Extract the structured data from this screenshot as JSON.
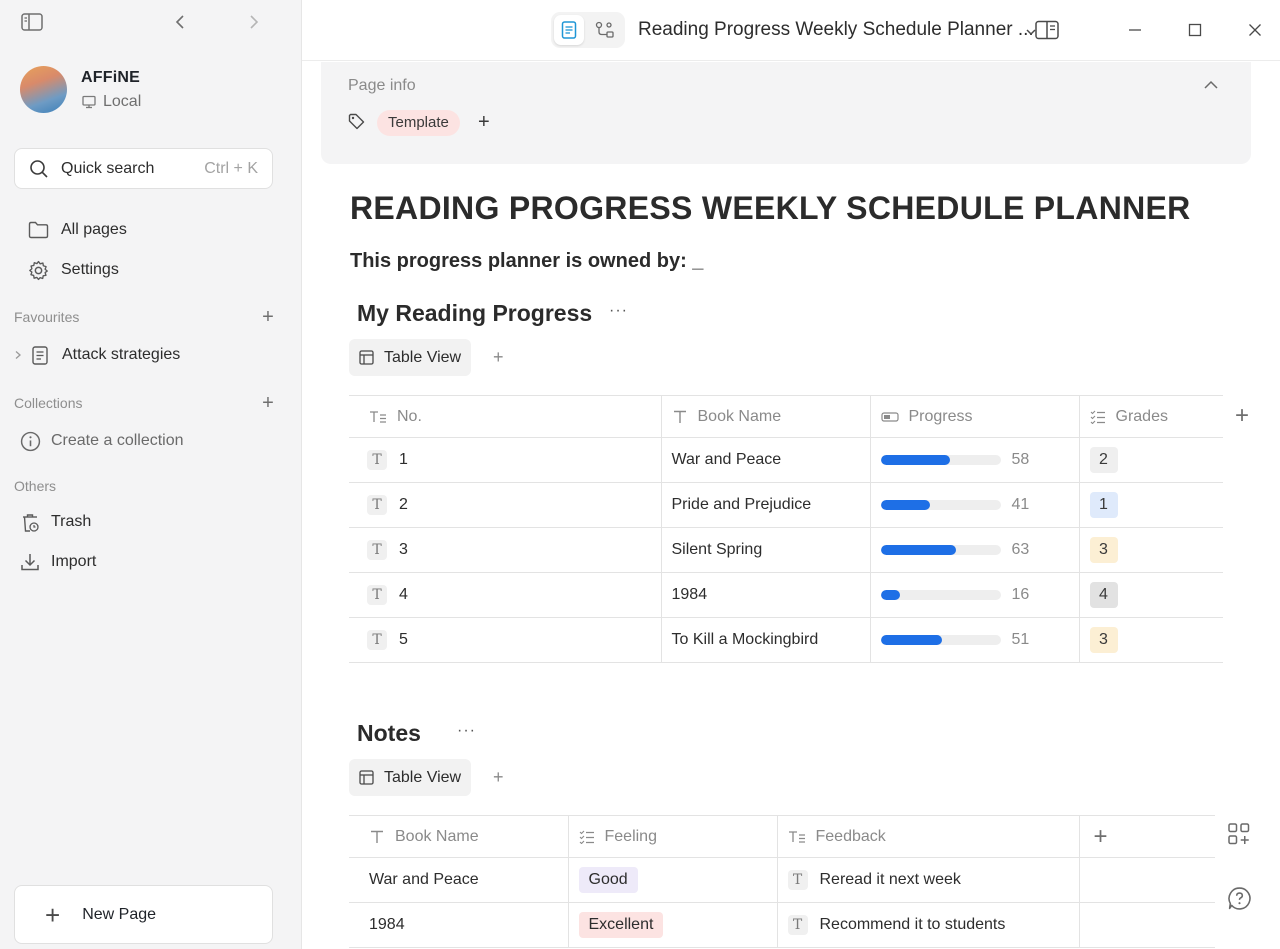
{
  "sidebar": {
    "workspace_name": "AFFiNE",
    "workspace_type": "Local",
    "search_label": "Quick search",
    "search_shortcut": "Ctrl + K",
    "nav": [
      {
        "label": "All pages",
        "icon": "folder-icon"
      },
      {
        "label": "Settings",
        "icon": "gear-icon"
      }
    ],
    "favourites_title": "Favourites",
    "favourites": [
      {
        "label": "Attack strategies",
        "icon": "page-icon"
      }
    ],
    "collections_title": "Collections",
    "create_collection": "Create a collection",
    "others_title": "Others",
    "others": [
      {
        "label": "Trash",
        "icon": "trash-icon"
      },
      {
        "label": "Import",
        "icon": "import-icon"
      }
    ],
    "new_page": "New Page"
  },
  "titlebar": {
    "doc_title": "Reading Progress Weekly Schedule Planner ...",
    "active_mode": "page"
  },
  "page_info": {
    "title": "Page info",
    "tags": [
      {
        "label": "Template",
        "color": "#fce3e2"
      }
    ]
  },
  "doc": {
    "heading": "READING PROGRESS WEEKLY SCHEDULE PLANNER",
    "owner_line": "This progress planner is owned by: _"
  },
  "progress_db": {
    "title": "My Reading Progress",
    "view_label": "Table View",
    "columns": [
      "No.",
      "Book Name",
      "Progress",
      "Grades"
    ],
    "rows": [
      {
        "no": "1",
        "book": "War and Peace",
        "progress": 58,
        "grade": "2",
        "grade_color": "#efefef"
      },
      {
        "no": "2",
        "book": "Pride and Prejudice",
        "progress": 41,
        "grade": "1",
        "grade_color": "#dfeafb"
      },
      {
        "no": "3",
        "book": "Silent Spring",
        "progress": 63,
        "grade": "3",
        "grade_color": "#fcefd4"
      },
      {
        "no": "4",
        "book": "1984",
        "progress": 16,
        "grade": "4",
        "grade_color": "#e2e2e2"
      },
      {
        "no": "5",
        "book": "To Kill a Mockingbird",
        "progress": 51,
        "grade": "3",
        "grade_color": "#fcefd4"
      }
    ]
  },
  "notes_db": {
    "title": "Notes",
    "view_label": "Table View",
    "columns": [
      "Book Name",
      "Feeling",
      "Feedback"
    ],
    "rows": [
      {
        "book": "War and Peace",
        "feeling": "Good",
        "feeling_color": "#eeeaf9",
        "feedback": "Reread it next week"
      },
      {
        "book": "1984",
        "feeling": "Excellent",
        "feeling_color": "#fce3e2",
        "feedback": "Recommend it to students"
      }
    ]
  },
  "colors": {
    "accent": "#1e6fe6",
    "tag_pink": "#fce3e2"
  }
}
